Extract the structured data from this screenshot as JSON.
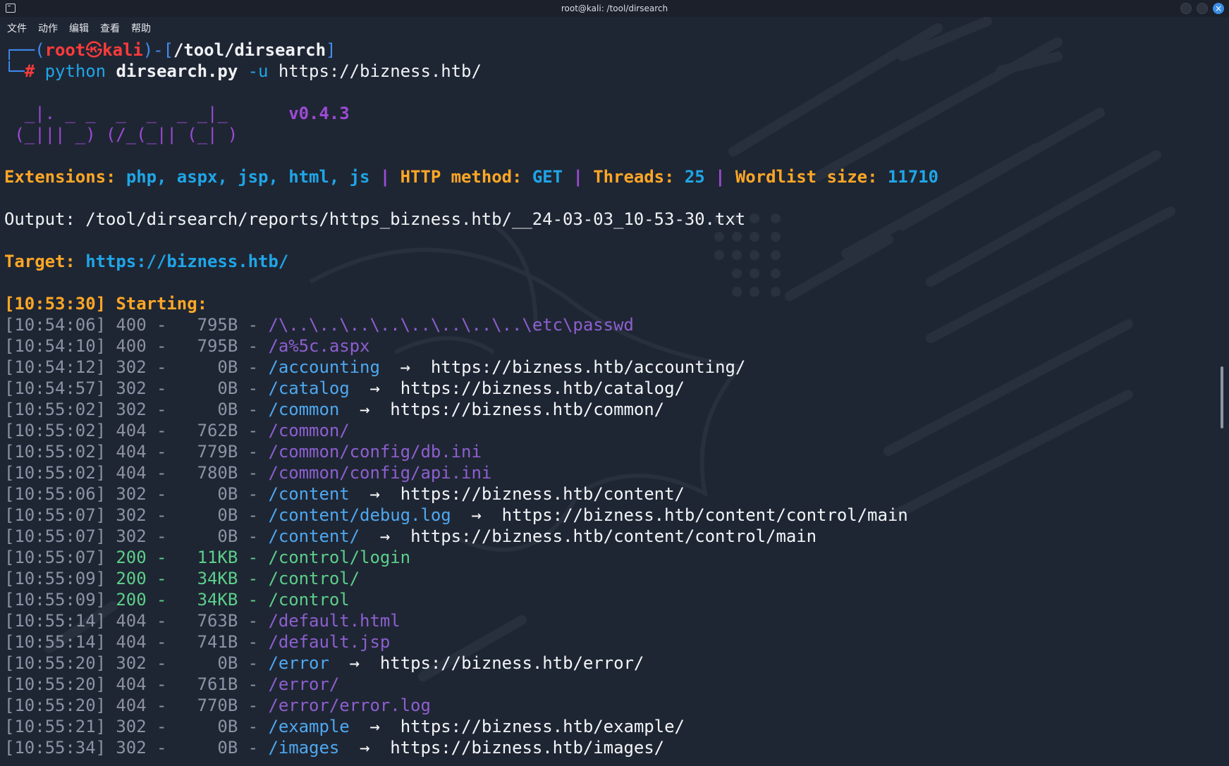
{
  "window": {
    "title": "root@kali: /tool/dirsearch",
    "close_label": "×"
  },
  "menu": {
    "items": [
      "文件",
      "动作",
      "编辑",
      "查看",
      "帮助"
    ]
  },
  "prompt": {
    "corner_top": "┌──(",
    "user": "root",
    "at_symbol": "㉿",
    "host": "kali",
    "mid": ")-[",
    "path": "/tool/dirsearch",
    "close": "]",
    "corner_bottom": "└─",
    "hash": "#",
    "cmd": "python",
    "script": "dirsearch.py",
    "flag": "-u",
    "arg": "https://bizness.htb/"
  },
  "banner": {
    "line1": "  _|. _ _  _  _  _ _|_",
    "line2": " (_||| _) (/_(_|| (_| )",
    "version": "v0.4.3"
  },
  "config": {
    "ext_label": "Extensions:",
    "ext_value": "php, aspx, jsp, html, js",
    "sep": "|",
    "method_label": "HTTP method:",
    "method_value": "GET",
    "threads_label": "Threads:",
    "threads_value": "25",
    "wordlist_label": "Wordlist size:",
    "wordlist_value": "11710"
  },
  "output": {
    "label": "Output:",
    "path": "/tool/dirsearch/reports/https_bizness.htb/__24-03-03_10-53-30.txt"
  },
  "target": {
    "label": "Target:",
    "url": "https://bizness.htb/"
  },
  "starting": {
    "time": "[10:53:30]",
    "label": "Starting:"
  },
  "results": [
    {
      "time": "[10:54:06]",
      "code": "400",
      "size": "795B",
      "path": "/\\..\\..\\..\\..\\..\\..\\..\\..\\etc\\passwd",
      "redirect": ""
    },
    {
      "time": "[10:54:10]",
      "code": "400",
      "size": "795B",
      "path": "/a%5c.aspx",
      "redirect": ""
    },
    {
      "time": "[10:54:12]",
      "code": "302",
      "size": "0B",
      "path": "/accounting",
      "redirect": "https://bizness.htb/accounting/"
    },
    {
      "time": "[10:54:57]",
      "code": "302",
      "size": "0B",
      "path": "/catalog",
      "redirect": "https://bizness.htb/catalog/"
    },
    {
      "time": "[10:55:02]",
      "code": "302",
      "size": "0B",
      "path": "/common",
      "redirect": "https://bizness.htb/common/"
    },
    {
      "time": "[10:55:02]",
      "code": "404",
      "size": "762B",
      "path": "/common/",
      "redirect": ""
    },
    {
      "time": "[10:55:02]",
      "code": "404",
      "size": "779B",
      "path": "/common/config/db.ini",
      "redirect": ""
    },
    {
      "time": "[10:55:02]",
      "code": "404",
      "size": "780B",
      "path": "/common/config/api.ini",
      "redirect": ""
    },
    {
      "time": "[10:55:06]",
      "code": "302",
      "size": "0B",
      "path": "/content",
      "redirect": "https://bizness.htb/content/"
    },
    {
      "time": "[10:55:07]",
      "code": "302",
      "size": "0B",
      "path": "/content/debug.log",
      "redirect": "https://bizness.htb/content/control/main"
    },
    {
      "time": "[10:55:07]",
      "code": "302",
      "size": "0B",
      "path": "/content/",
      "redirect": "https://bizness.htb/content/control/main"
    },
    {
      "time": "[10:55:07]",
      "code": "200",
      "size": "11KB",
      "path": "/control/login",
      "redirect": ""
    },
    {
      "time": "[10:55:09]",
      "code": "200",
      "size": "34KB",
      "path": "/control/",
      "redirect": ""
    },
    {
      "time": "[10:55:09]",
      "code": "200",
      "size": "34KB",
      "path": "/control",
      "redirect": ""
    },
    {
      "time": "[10:55:14]",
      "code": "404",
      "size": "763B",
      "path": "/default.html",
      "redirect": ""
    },
    {
      "time": "[10:55:14]",
      "code": "404",
      "size": "741B",
      "path": "/default.jsp",
      "redirect": ""
    },
    {
      "time": "[10:55:20]",
      "code": "302",
      "size": "0B",
      "path": "/error",
      "redirect": "https://bizness.htb/error/"
    },
    {
      "time": "[10:55:20]",
      "code": "404",
      "size": "761B",
      "path": "/error/",
      "redirect": ""
    },
    {
      "time": "[10:55:20]",
      "code": "404",
      "size": "770B",
      "path": "/error/error.log",
      "redirect": ""
    },
    {
      "time": "[10:55:21]",
      "code": "302",
      "size": "0B",
      "path": "/example",
      "redirect": "https://bizness.htb/example/"
    },
    {
      "time": "[10:55:34]",
      "code": "302",
      "size": "0B",
      "path": "/images",
      "redirect": "https://bizness.htb/images/"
    }
  ],
  "symbols": {
    "dash": "-",
    "arrow": "→"
  },
  "colors": {
    "background": "#1f2633",
    "prompt_red": "#ff3b3b",
    "prompt_blue": "#3f8df3",
    "banner_purple": "#9c4bd6",
    "config_orange": "#ffa726",
    "config_cyan": "#1fa6e8",
    "status_400_404": "#8d5fd0",
    "status_302": "#4ea8f0",
    "status_200": "#5ccf8a"
  }
}
